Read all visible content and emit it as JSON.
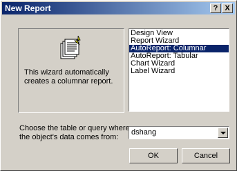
{
  "window": {
    "title": "New Report",
    "help_button": "?",
    "close_button": "X"
  },
  "preview": {
    "icon": "report-wizard-icon",
    "description": "This wizard automatically creates a columnar report."
  },
  "wizard_list": {
    "items": [
      "Design View",
      "Report Wizard",
      "AutoReport: Columnar",
      "AutoReport: Tabular",
      "Chart Wizard",
      "Label Wizard"
    ],
    "selected": "AutoReport: Columnar"
  },
  "source": {
    "label": "Choose the table or query where the object's data comes from:",
    "value": "dshang"
  },
  "buttons": {
    "ok": "OK",
    "cancel": "Cancel"
  },
  "colors": {
    "title_bar": "#0a246a",
    "selection": "#0a246a",
    "face": "#d4d0c8"
  }
}
